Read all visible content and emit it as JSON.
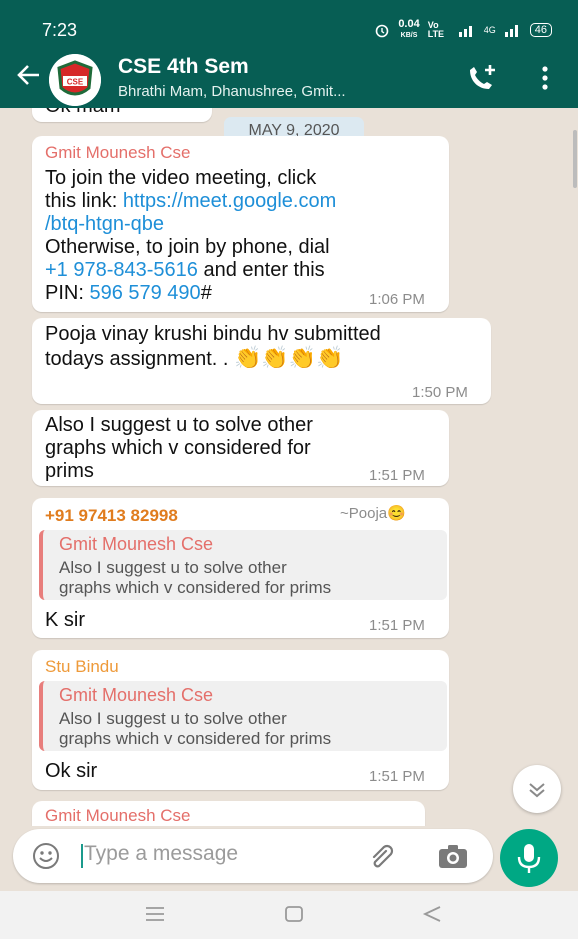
{
  "status_bar": {
    "time": "7:23",
    "net_speed": "0.04",
    "net_unit": "KB/S",
    "volte": "Vo LTE",
    "net_type": "4G",
    "battery": "46"
  },
  "header": {
    "title": "CSE 4th Sem",
    "subtitle": "Bhrathi Mam, Dhanushree, Gmit...",
    "avatar_text": "CSE"
  },
  "chat": {
    "partial_top": "Ok mam",
    "date": "MAY 9, 2020",
    "m1": {
      "sender": "Gmit Mounesh Cse",
      "line1": "To join the video meeting, click",
      "line2_a": "this link: ",
      "line2_link": "https://meet.google.com",
      "line3_link": "/btq-htgn-qbe",
      "line4": "Otherwise, to join by phone, dial",
      "line5_phone": "+1 978-843-5616",
      "line5_b": " and enter this",
      "line6_a": "PIN: ",
      "line6_pin": "596 579 490",
      "line6_b": "#",
      "time": "1:06 PM"
    },
    "m2": {
      "line1": "Pooja vinay krushi bindu hv submitted",
      "line2": "todays assignment. . ",
      "emoji": "👏👏👏👏",
      "time": "1:50 PM"
    },
    "m3": {
      "line1": "Also I suggest u to solve other",
      "line2": "graphs which v considered for",
      "line3": "prims",
      "time": "1:51 PM"
    },
    "m4": {
      "sender": "+91 97413 82998",
      "push_name": "~Pooja😊",
      "quote_name": "Gmit Mounesh Cse",
      "quote_line1": "Also I suggest u to solve other",
      "quote_line2": "graphs which v considered for prims",
      "text": "K sir",
      "time": "1:51 PM"
    },
    "m5": {
      "sender": "Stu Bindu",
      "quote_name": "Gmit Mounesh Cse",
      "quote_line1": "Also I suggest u to solve other",
      "quote_line2": "graphs which v considered for prims",
      "text": "Ok sir",
      "time": "1:51 PM"
    },
    "m6": {
      "sender": "Gmit Mounesh Cse"
    }
  },
  "input": {
    "placeholder": "Type a message"
  },
  "colors": {
    "header": "#075e54",
    "chat_bg": "#e9e1d8",
    "accent": "#00a884",
    "link": "#1e8fd8"
  }
}
